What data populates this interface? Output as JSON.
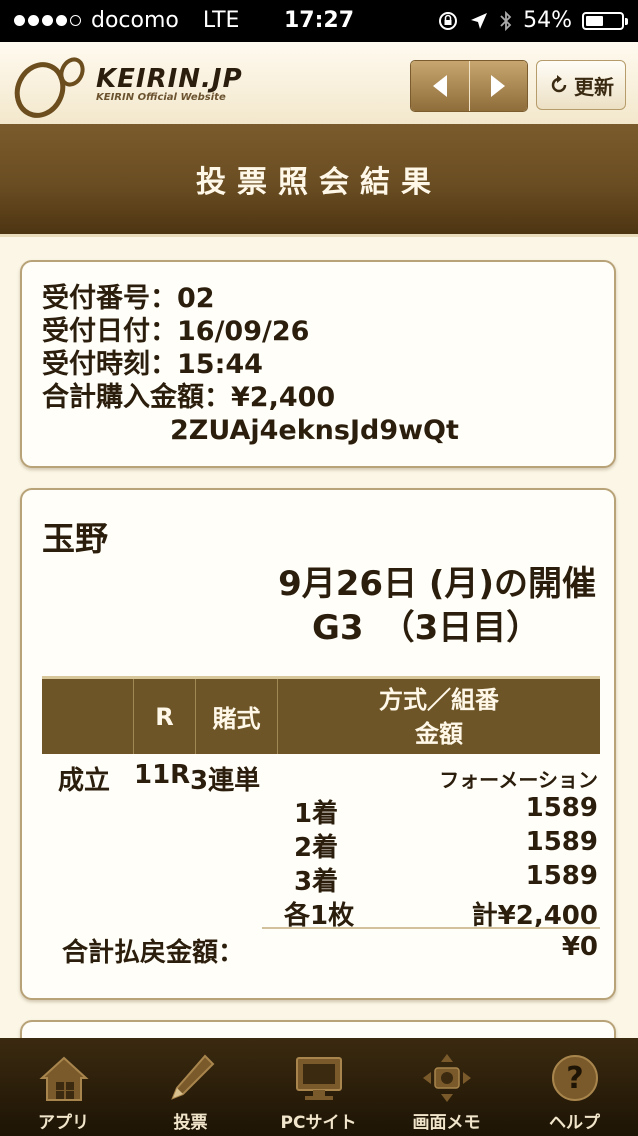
{
  "status_bar": {
    "carrier": "docomo",
    "network": "LTE",
    "time": "17:27",
    "battery_percent": "54%",
    "signal_bars": 4,
    "battery_level": 0.54
  },
  "header": {
    "logo_main": "KEIRIN.JP",
    "logo_sub": "KEIRIN Official Website",
    "back_icon": "chevron-left-icon",
    "forward_icon": "chevron-right-icon",
    "refresh_label": "更新"
  },
  "page_title": "投票照会結果",
  "receipt": {
    "number": "受付番号：02",
    "date": "受付日付：16/09/26",
    "time": "受付時刻：15:44",
    "total_purchase": "合計購入金額：¥2,400",
    "code": "2ZUAj4eknsJd9wQt"
  },
  "race": {
    "venue": "玉野",
    "date": "9月26日 (月)の開催",
    "grade": "G3　（3日目）",
    "table_headers": {
      "col0": "",
      "race": "R",
      "bet_type": "賭式",
      "method_line1": "方式／組番",
      "method_line2": "金額"
    },
    "bet": {
      "status": "成立",
      "race": "11R",
      "bet_type": "3連単",
      "method": "フォーメーション",
      "legs": [
        {
          "place": "1着",
          "numbers": "1589"
        },
        {
          "place": "2着",
          "numbers": "1589"
        },
        {
          "place": "3着",
          "numbers": "1589"
        }
      ],
      "per_ticket": "各1枚",
      "total": "計¥2,400"
    },
    "payout_label": "合計払戻金額：",
    "payout_amount": "¥0"
  },
  "tabbar": {
    "items": [
      {
        "label": "アプリ",
        "icon": "home-icon"
      },
      {
        "label": "投票",
        "icon": "pencil-icon"
      },
      {
        "label": "PCサイト",
        "icon": "monitor-icon"
      },
      {
        "label": "画面メモ",
        "icon": "camera-move-icon"
      },
      {
        "label": "ヘルプ",
        "icon": "help-icon"
      }
    ]
  }
}
